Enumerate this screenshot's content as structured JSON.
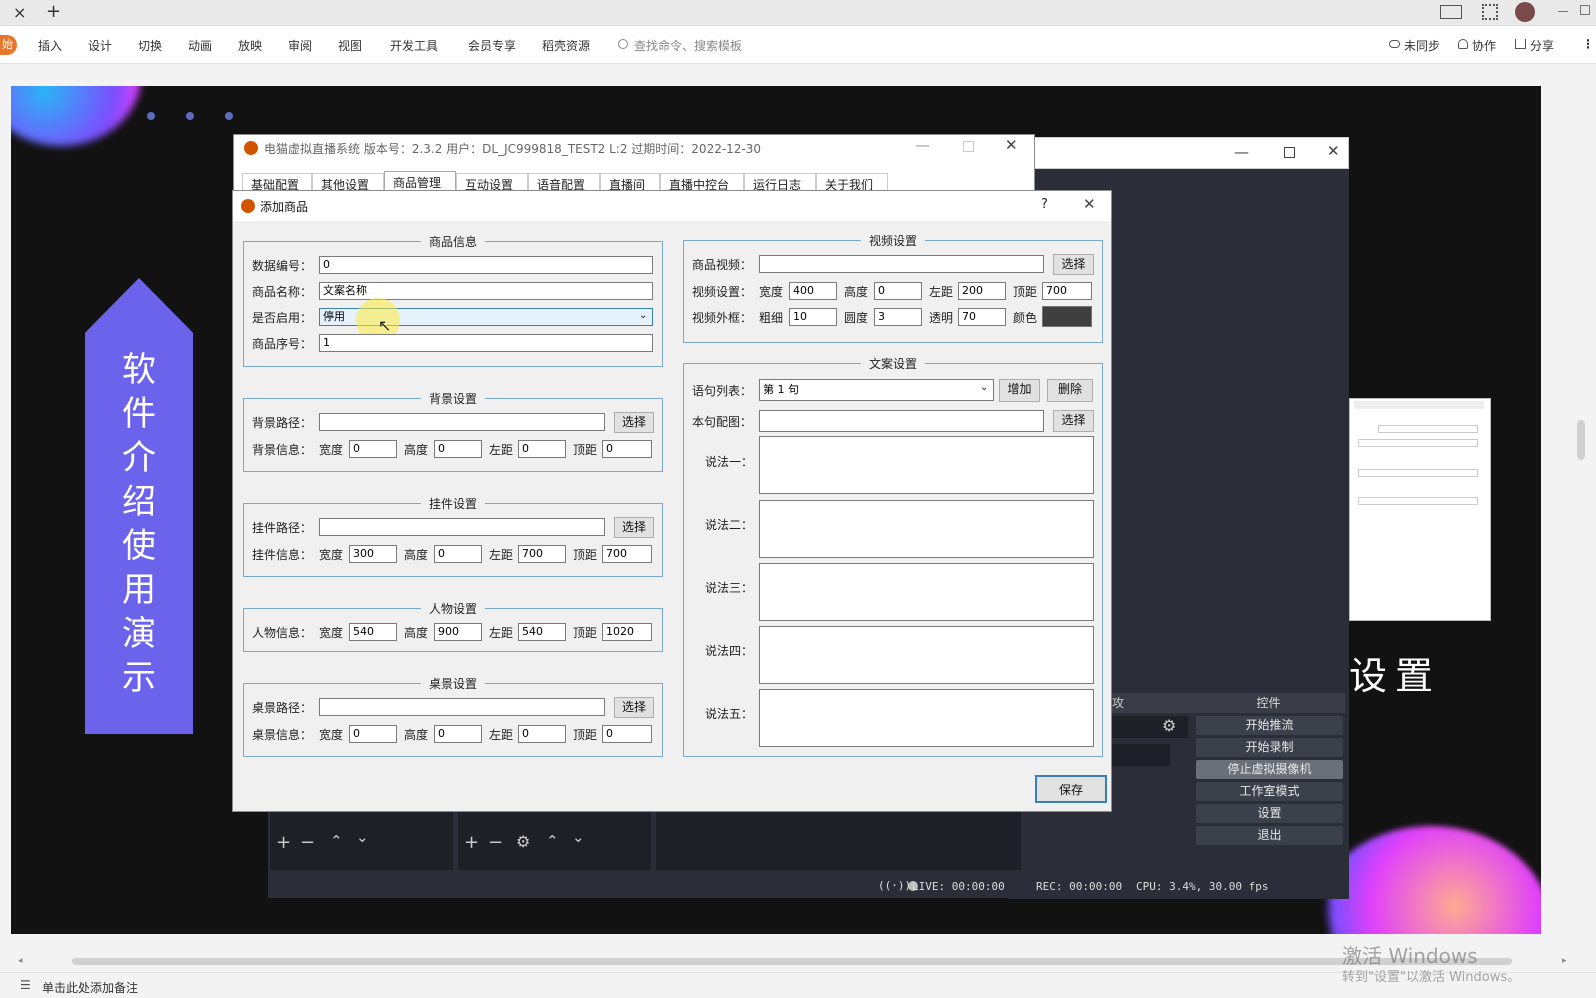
{
  "tabbar": {
    "close_glyph": "×",
    "new_tab_glyph": "+"
  },
  "ribbon": {
    "start": "始",
    "items": [
      "插入",
      "设计",
      "切换",
      "动画",
      "放映",
      "审阅",
      "视图",
      "开发工具",
      "会员专享",
      "稻壳资源"
    ],
    "search_placeholder": "查找命令、搜索模板",
    "sync": "未同步",
    "collab": "协作",
    "share": "分享"
  },
  "slide": {
    "banner_text": "软件介绍使用演示",
    "right_heading": "设置"
  },
  "app_window": {
    "title": "电猫虚拟直播系统 版本号：2.3.2 用户：DL_JC999818_TEST2 L:2 过期时间：2022-12-30",
    "tabs": [
      "基础配置",
      "其他设置",
      "商品管理",
      "互动设置",
      "语音配置",
      "直播间",
      "直播中控台",
      "运行日志",
      "关于我们"
    ]
  },
  "dialog": {
    "title": "添加商品",
    "help": "?",
    "product_info": {
      "title": "商品信息",
      "id_label": "数据编号：",
      "id_value": "0",
      "name_label": "商品名称：",
      "name_value": "文案名称",
      "enabled_label": "是否启用：",
      "enabled_value": "停用",
      "seq_label": "商品序号：",
      "seq_value": "1"
    },
    "background": {
      "title": "背景设置",
      "path_label": "背景路径：",
      "path_value": "",
      "choose": "选择",
      "info_label": "背景信息：",
      "w_label": "宽度",
      "w": "0",
      "h_label": "高度",
      "h": "0",
      "l_label": "左距",
      "l": "0",
      "t_label": "顶距",
      "t": "0"
    },
    "pendant": {
      "title": "挂件设置",
      "path_label": "挂件路径：",
      "path_value": "",
      "choose": "选择",
      "info_label": "挂件信息：",
      "w_label": "宽度",
      "w": "300",
      "h_label": "高度",
      "h": "0",
      "l_label": "左距",
      "l": "700",
      "t_label": "顶距",
      "t": "700"
    },
    "person": {
      "title": "人物设置",
      "info_label": "人物信息：",
      "w_label": "宽度",
      "w": "540",
      "h_label": "高度",
      "h": "900",
      "l_label": "左距",
      "l": "540",
      "t_label": "顶距",
      "t": "1020"
    },
    "desktop": {
      "title": "桌景设置",
      "path_label": "桌景路径：",
      "path_value": "",
      "choose": "选择",
      "info_label": "桌景信息：",
      "w_label": "宽度",
      "w": "0",
      "h_label": "高度",
      "h": "0",
      "l_label": "左距",
      "l": "0",
      "t_label": "顶距",
      "t": "0"
    },
    "video": {
      "title": "视频设置",
      "video_label": "商品视频：",
      "video_value": "",
      "choose": "选择",
      "set_label": "视频设置：",
      "w_label": "宽度",
      "w": "400",
      "h_label": "高度",
      "h": "0",
      "l_label": "左距",
      "l": "200",
      "t_label": "顶距",
      "t": "700",
      "frame_label": "视频外框：",
      "thick_label": "粗细",
      "thick": "10",
      "radius_label": "圆度",
      "radius": "3",
      "alpha_label": "透明",
      "alpha": "70",
      "color_label": "颜色",
      "color_value": "#3f3f3f"
    },
    "copy": {
      "title": "文案设置",
      "list_label": "语句列表：",
      "list_value": "第 1 句",
      "add": "增加",
      "del": "删除",
      "img_label": "本句配图：",
      "img_value": "",
      "choose": "选择",
      "s1": "说法一：",
      "s2": "说法二：",
      "s3": "说法三：",
      "s4": "说法四：",
      "s5": "说法五："
    },
    "save": "保存"
  },
  "obs": {
    "controls_title": "控件",
    "buttons": [
      "开始推流",
      "开始录制",
      "停止虚拟摄像机",
      "工作室模式",
      "设置",
      "退出"
    ],
    "live": "LIVE: 00:00:00",
    "rec": "REC: 00:00:00",
    "cpu": "CPU: 3.4%, 30.00 fps",
    "partial_label": "攻"
  },
  "status": {
    "notes": "单击此处添加备注"
  },
  "watermark": {
    "line1": "激活 Windows",
    "line2": "转到\"设置\"以激活 Windows。"
  },
  "colors": {
    "banner": "#6c5ce7",
    "ribbon_accent": "#e8772e",
    "dialog_border": "#7aa7cc"
  }
}
